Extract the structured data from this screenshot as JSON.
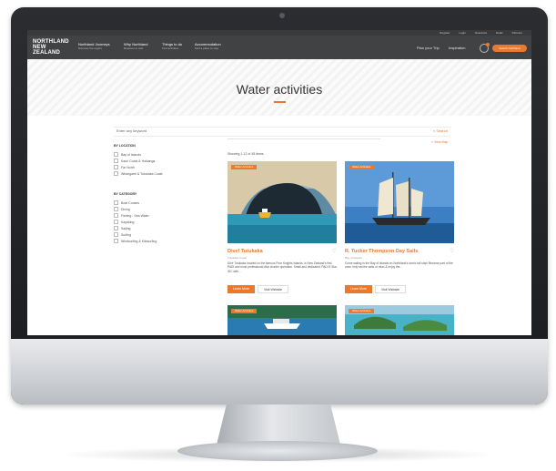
{
  "utility_links": [
    "Register",
    "Login",
    "Itineraries",
    "Deals",
    "Partners"
  ],
  "logo": {
    "line1": "NORTHLAND",
    "line2": "NEW ZEALAND"
  },
  "nav": [
    {
      "title": "Northland Journeys",
      "subtitle": "Discover the region"
    },
    {
      "title": "Why Northland",
      "subtitle": "Reasons to visit"
    },
    {
      "title": "Things to do",
      "subtitle": "Find activities"
    },
    {
      "title": "Accommodation",
      "subtitle": "Find a place to stay"
    }
  ],
  "right_nav": {
    "plan": "Plan your Trip",
    "inspiration": "Inspiration"
  },
  "cta": "Search Northland",
  "page_title": "Water activities",
  "search": {
    "placeholder": "Enter any keyword",
    "button": "Search"
  },
  "view_map": "View Map",
  "filters": {
    "location_heading": "BY LOCATION",
    "locations": [
      "Bay of Islands",
      "Kauri Coast & Hokianga",
      "Far North",
      "Whangarei & Tutukaka Coast"
    ],
    "category_heading": "BY CATEGORY",
    "categories": [
      "Boat Cruises",
      "Diving",
      "Fishing - Sea Water",
      "Kayaking",
      "Sailing",
      "Surfing",
      "Windsurfing & Kitesurfing"
    ]
  },
  "showing": "Showing 1-12 of 48 items",
  "cards": [
    {
      "tag": "Water Activities",
      "title": "Dive! Tutukaka",
      "subtitle": "Tutukaka Coast",
      "desc": "Dive Tutukaka located on the famous Poor Knights Islands, is New Zealand's first PADI and most professional dive charter operation. Small and dedicated, PADI 5 Star IDC with...",
      "btn1": "Learn More",
      "btn2": "Visit Website"
    },
    {
      "tag": "Water Activities",
      "title": "R. Tucker Thompson Day Sails",
      "subtitle": "Bay of Islands",
      "desc": "Come sailing in the Bay of Islands on Northland's iconic tall ship! Become part of the crew, help set the sails or relax & enjoy the...",
      "btn1": "Learn More",
      "btn2": "Visit Website"
    },
    {
      "tag": "Water Activities"
    },
    {
      "tag": "Water Activities"
    }
  ]
}
